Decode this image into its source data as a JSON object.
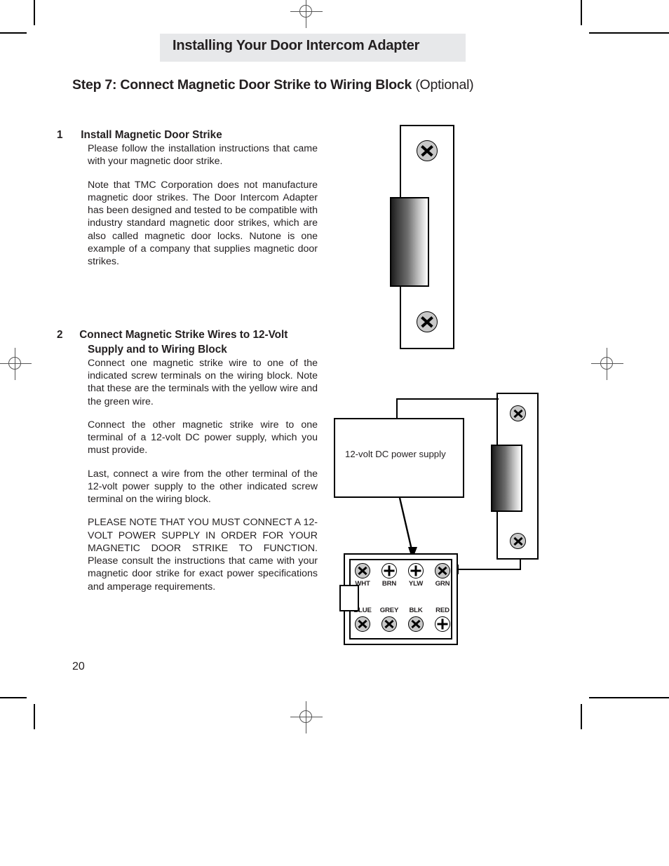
{
  "page": {
    "running_header": "Installing Your Door Intercom Adapter",
    "step_heading_bold": "Step 7: Connect Magnetic Door Strike to Wiring Block",
    "step_heading_regular": "(Optional)",
    "page_number": "20",
    "band_color": "#e7e8ea"
  },
  "items": [
    {
      "number": "1",
      "title": "Install Magnetic Door Strike",
      "paragraphs": [
        "Please follow the installation instructions that came with your magnetic door strike.",
        "Note that TMC Corporation does not manufacture magnetic door strikes.  The Door Intercom Adapter has been designed and tested to be compatible with industry standard magnetic door strikes, which are also called magnetic door locks.  Nutone is one example of a company that supplies magnetic door strikes."
      ]
    },
    {
      "number": "2",
      "title": "Connect Magnetic Strike Wires to 12-Volt Supply and to Wiring Block",
      "paragraphs": [
        "Connect one magnetic strike wire to one of the indicated screw terminals on the wiring block. Note that these are the terminals with the yellow wire and the green wire.",
        "Connect the other magnetic strike wire to one terminal of a 12-volt DC power supply, which you must provide.",
        "Last, connect a wire from the other terminal of the 12-volt power supply to the other indicated screw terminal on the wiring block.",
        "PLEASE NOTE THAT YOU MUST CONNECT A 12-VOLT POWER SUPPLY IN ORDER FOR YOUR MAGNETIC DOOR STRIKE TO FUNCTION.   Please consult the instructions that came with your magnetic door strike for exact power specifications and amperage requirements."
      ]
    }
  ],
  "diagrams": {
    "power_supply_label": "12-volt DC power supply",
    "wiring_block": {
      "top_row": [
        {
          "label": "WHT",
          "screw_style": "gray",
          "slot": "x"
        },
        {
          "label": "BRN",
          "screw_style": "white",
          "slot": "plus"
        },
        {
          "label": "YLW",
          "screw_style": "white",
          "slot": "plus"
        },
        {
          "label": "GRN",
          "screw_style": "gray",
          "slot": "x"
        }
      ],
      "bottom_row": [
        {
          "label": "BLUE",
          "screw_style": "gray",
          "slot": "x"
        },
        {
          "label": "GREY",
          "screw_style": "gray",
          "slot": "x"
        },
        {
          "label": "BLK",
          "screw_style": "gray",
          "slot": "x"
        },
        {
          "label": "RED",
          "screw_style": "white",
          "slot": "plus"
        }
      ]
    }
  }
}
